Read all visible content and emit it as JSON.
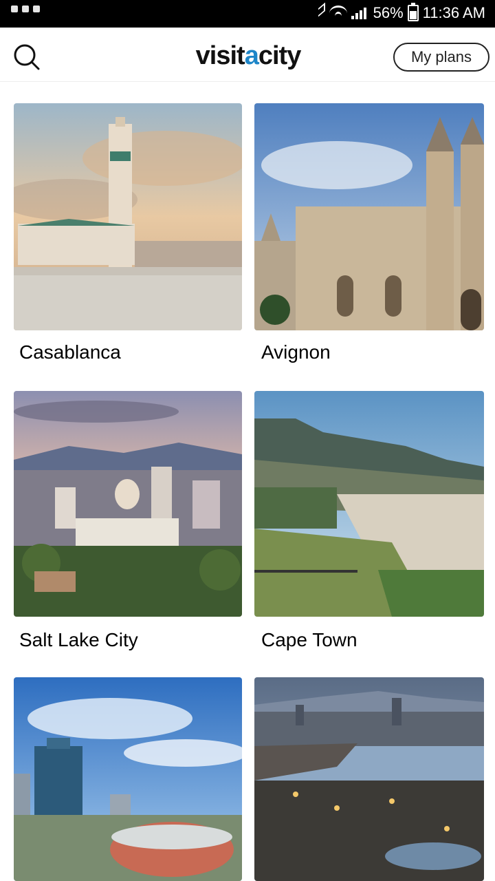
{
  "status_bar": {
    "battery": "56%",
    "time": "11:36 AM"
  },
  "header": {
    "logo_text_prefix": "visit",
    "logo_text_accent": "a",
    "logo_text_suffix": "city",
    "my_plans_label": "My plans"
  },
  "cities": [
    {
      "name": "Casablanca"
    },
    {
      "name": "Avignon"
    },
    {
      "name": "Salt Lake City"
    },
    {
      "name": "Cape Town"
    },
    {
      "name": ""
    },
    {
      "name": ""
    }
  ],
  "colors": {
    "accent": "#1e86c8",
    "text": "#000000",
    "background": "#ffffff"
  }
}
